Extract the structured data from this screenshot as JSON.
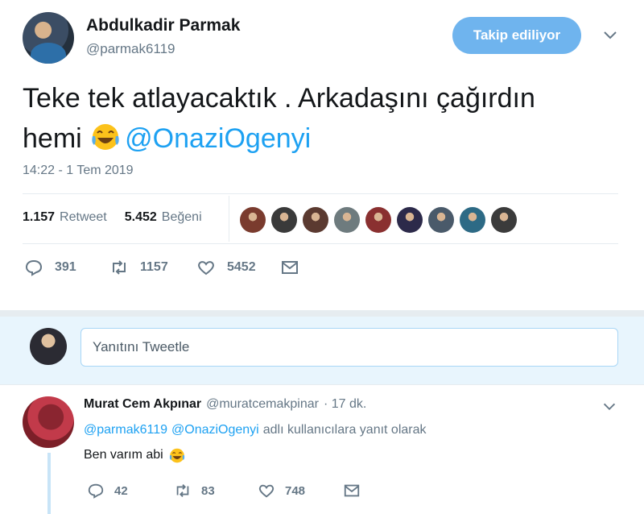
{
  "tweet": {
    "name": "Abdulkadir Parmak",
    "handle": "@parmak6119",
    "follow_label": "Takip ediliyor",
    "text_line1": "Teke tek atlayacaktık . Arkadaşını çağırdın",
    "text_line2_word": "hemi",
    "mention": "@OnaziOgenyi",
    "timestamp": "14:22 - 1 Tem 2019",
    "retweets_count": "1.157",
    "retweets_label": "Retweet",
    "likes_count": "5.452",
    "likes_label": "Beğeni",
    "likers": [
      "#7a3b2e",
      "#3a3a3a",
      "#5b3a30",
      "#6e7b7e",
      "#8a3030",
      "#2c2a4a",
      "#4a5a6a",
      "#2d6a85",
      "#3b3b3b"
    ],
    "actions": {
      "replies": "391",
      "retweets": "1157",
      "likes": "5452"
    }
  },
  "reply_box": {
    "placeholder": "Yanıtını Tweetle"
  },
  "reply": {
    "name": "Murat Cem Akpınar",
    "handle": "@muratcemakpinar",
    "time": "· 17 dk.",
    "replying_to_1": "@parmak6119",
    "replying_to_2": "@OnaziOgenyi",
    "replying_suffix": "adlı kullanıcılara yanıt olarak",
    "text": "Ben varım abi",
    "actions": {
      "replies": "42",
      "retweets": "83",
      "likes": "748"
    }
  },
  "colors": {
    "accent": "#1da1f2",
    "follow_button": "#6fb4ee",
    "muted": "#657786",
    "reply_bg": "#e8f5fd"
  },
  "icons": [
    "caret-down-icon",
    "laughing-emoji-icon",
    "reply-icon",
    "retweet-icon",
    "like-icon",
    "message-icon"
  ]
}
